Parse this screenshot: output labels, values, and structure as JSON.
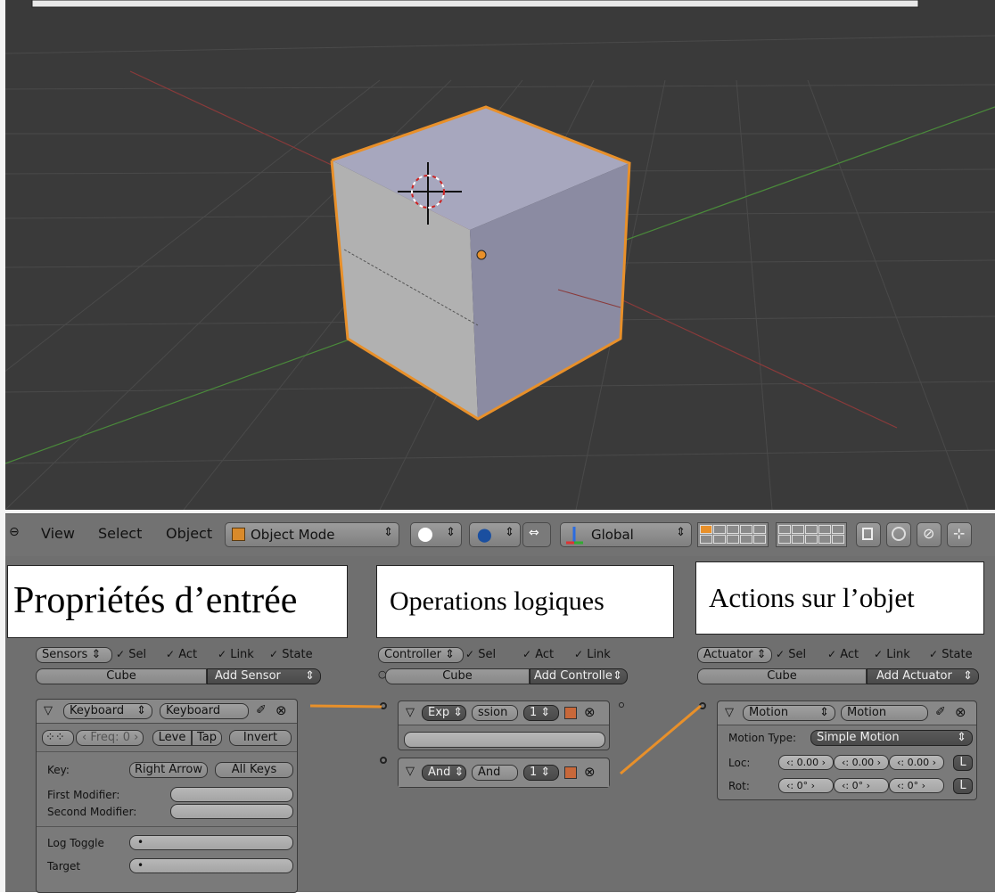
{
  "header": {
    "menu_view": "View",
    "menu_select": "Select",
    "menu_object": "Object",
    "mode": "Object Mode",
    "orientation": "Global",
    "icons": [
      "circle-icon",
      "cube-icon",
      "shading-sphere-icon",
      "pivot-icon",
      "manipulator-icon",
      "transform-axes-icon",
      "layers-grid-icon",
      "lock-icon",
      "proportional-icon",
      "snap-icon",
      "snap-target-icon"
    ]
  },
  "annotations": {
    "sensors_title": "Propriétés d’entrée",
    "controllers_title": "Operations logiques",
    "actuators_title": "Actions sur l’objet"
  },
  "sensors": {
    "dropdown": "Sensors",
    "flags": [
      "Sel",
      "Act",
      "Link",
      "State"
    ],
    "object": "Cube",
    "add": "Add Sensor",
    "brick": {
      "type": "Keyboard",
      "name": "Keyboard",
      "freq": "Freq: 0",
      "level": "Leve",
      "tap": "Tap",
      "invert": "Invert",
      "key_label": "Key:",
      "key_value": "Right Arrow",
      "all_keys": "All Keys",
      "first_modifier": "First Modifier:",
      "second_modifier": "Second Modifier:",
      "log_toggle": "Log Toggle",
      "target": "Target",
      "log_toggle_value": "•",
      "target_value": "•"
    }
  },
  "controllers": {
    "dropdown": "Controller",
    "flags": [
      "Sel",
      "Act",
      "Link"
    ],
    "object": "Cube",
    "add": "Add Controlle",
    "expr": {
      "type": "Exp",
      "name": "ssion",
      "state": "1"
    },
    "and": {
      "type": "And",
      "name": "And",
      "state": "1"
    }
  },
  "actuators": {
    "dropdown": "Actuator",
    "flags": [
      "Sel",
      "Act",
      "Link",
      "State"
    ],
    "object": "Cube",
    "add": "Add Actuator",
    "brick": {
      "type": "Motion",
      "name": "Motion",
      "motion_type_label": "Motion Type:",
      "motion_type": "Simple Motion",
      "loc_label": "Loc:",
      "rot_label": "Rot:",
      "loc": [
        "0.00",
        "0.00",
        "0.00"
      ],
      "rot": [
        "0°",
        "0°",
        "0°"
      ],
      "local": "L"
    }
  }
}
